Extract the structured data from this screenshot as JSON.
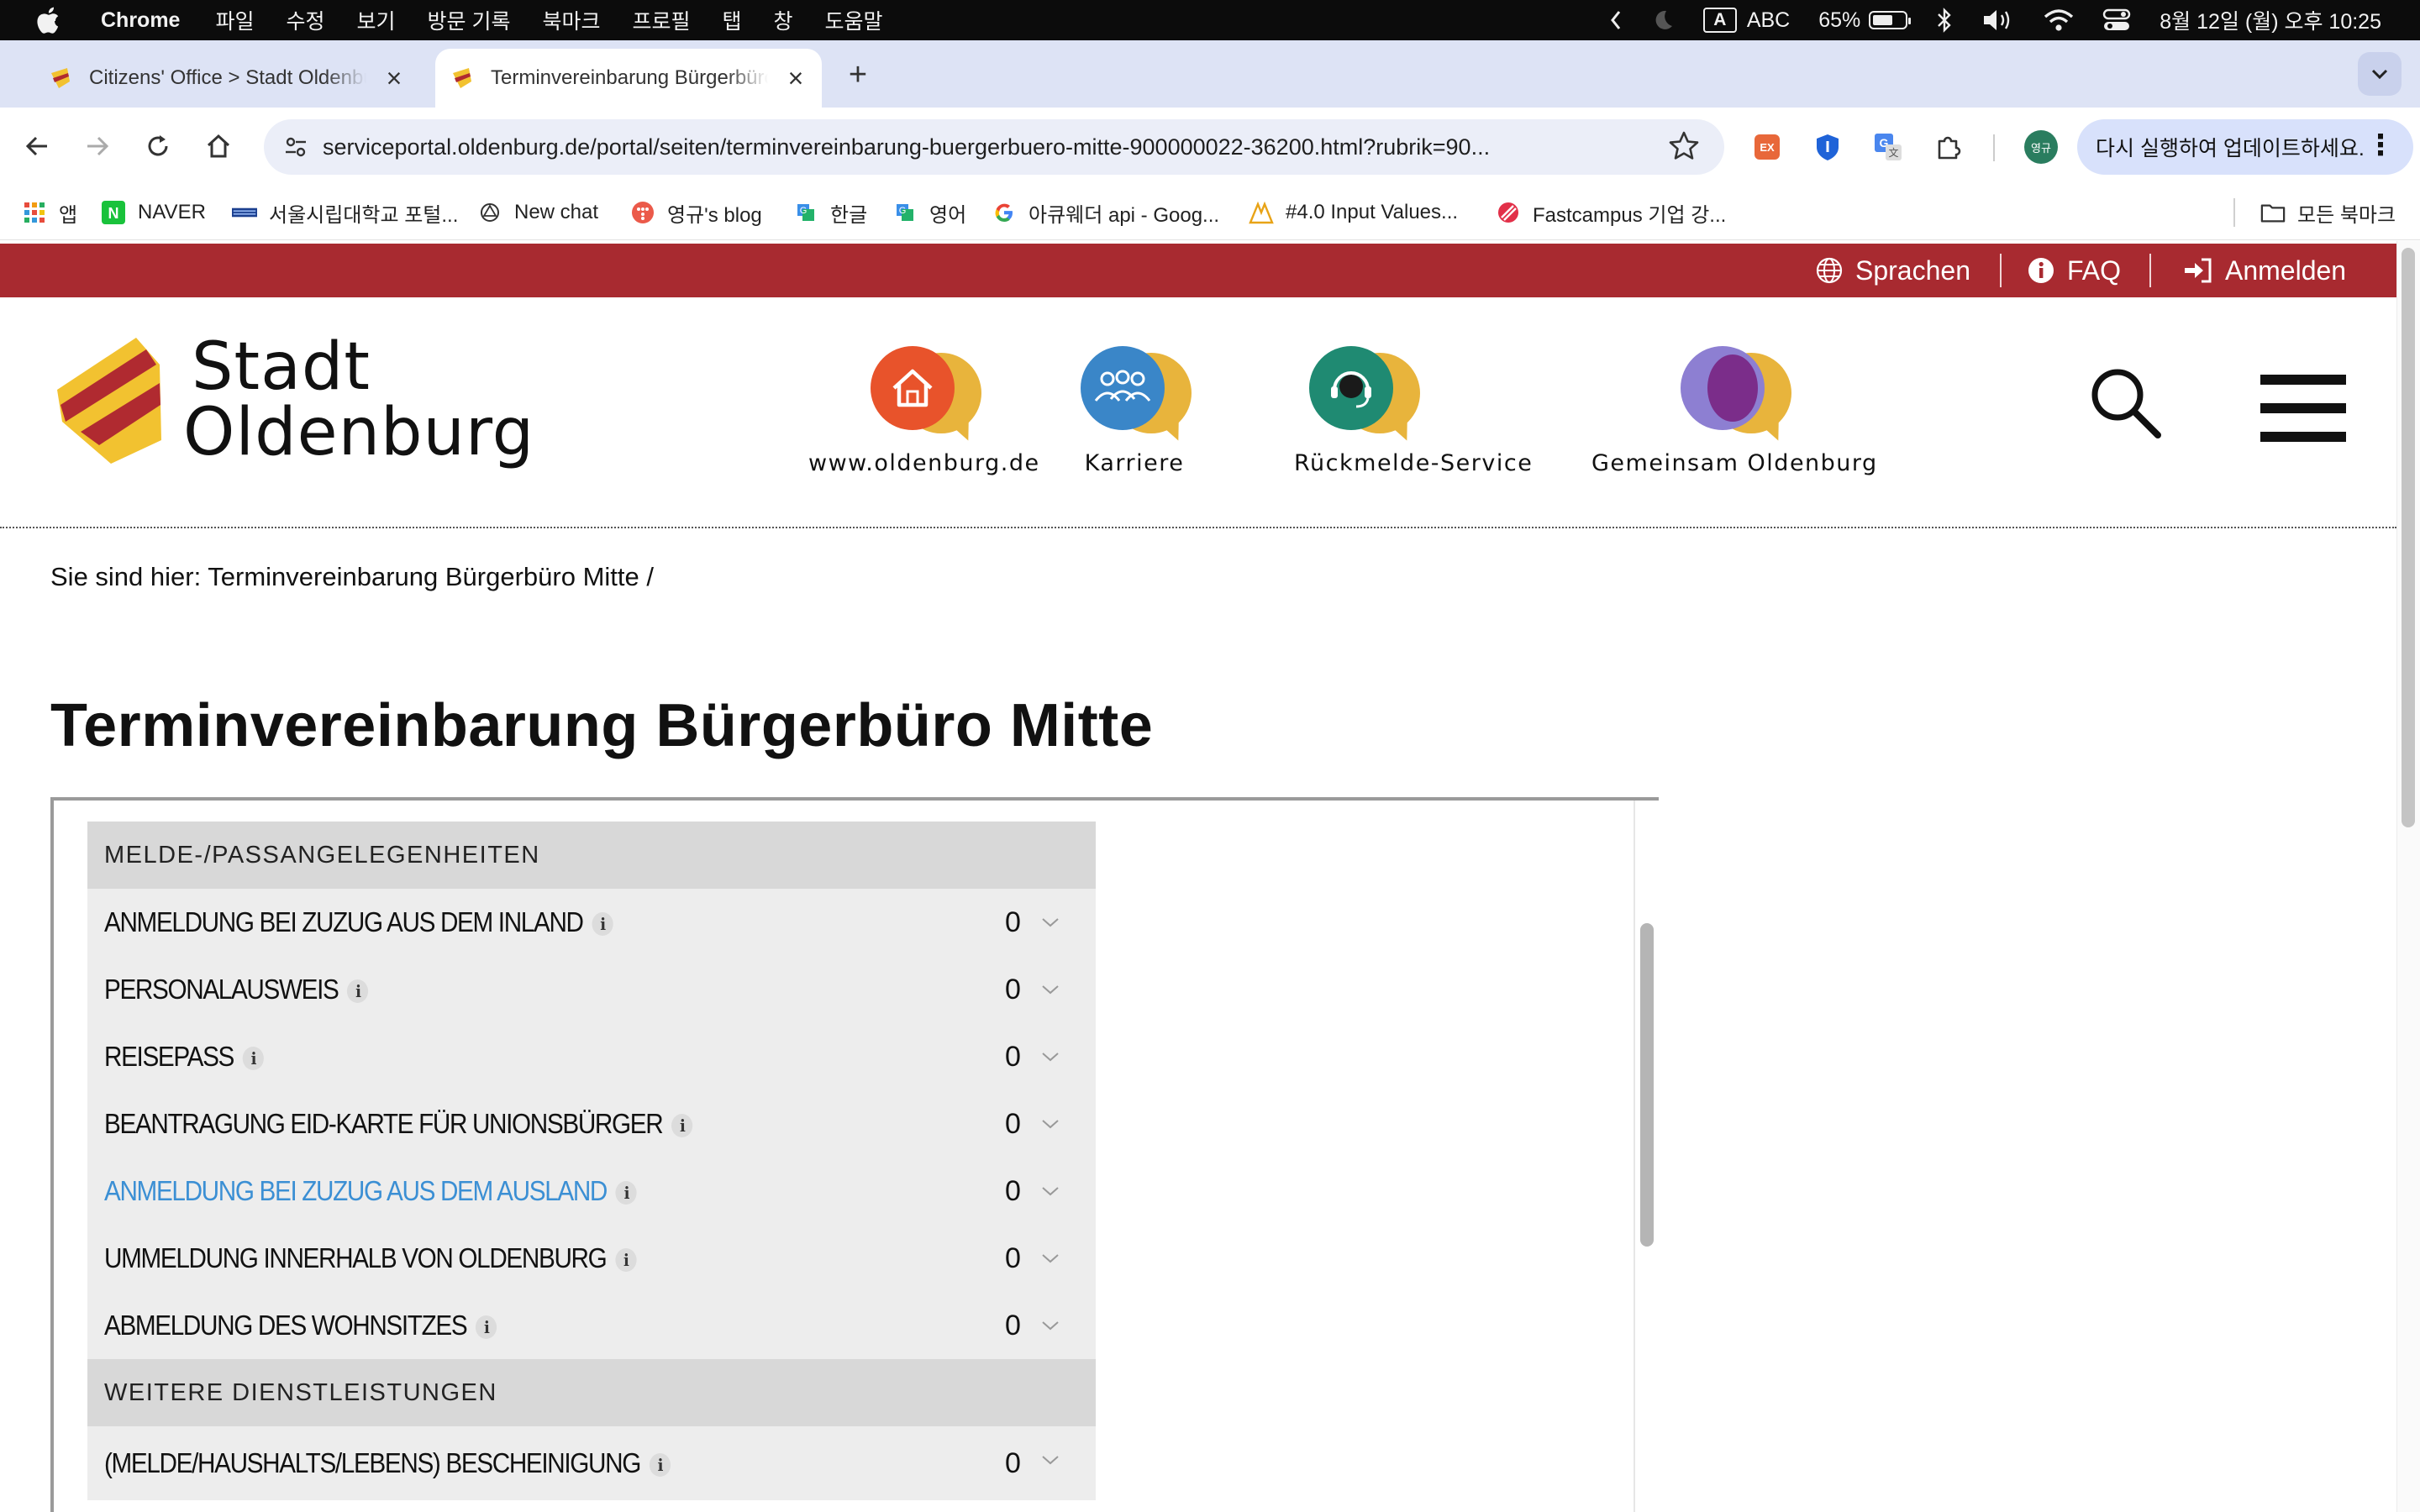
{
  "menubar": {
    "app": "Chrome",
    "items": [
      "파일",
      "수정",
      "보기",
      "방문 기록",
      "북마크",
      "프로필",
      "탭",
      "창",
      "도움말"
    ],
    "tray": {
      "input_method": "A",
      "input_label": "ABC",
      "battery": "65%",
      "battery_level": 0.65,
      "clock": "8월 12일 (월) 오후 10:25"
    }
  },
  "tabs": [
    {
      "title": "Citizens' Office > Stadt Oldenburg",
      "active": false
    },
    {
      "title": "Terminvereinbarung Bürgerbüro Mitte",
      "active": true
    }
  ],
  "toolbar": {
    "url": "serviceportal.oldenburg.de/portal/seiten/terminvereinbarung-buergerbuero-mitte-900000022-36200.html?rubrik=90...",
    "profile_label": "영규",
    "update_label": "다시 실행하여 업데이트하세요."
  },
  "bookmarks": [
    {
      "label": "앱",
      "icon": "apps-grid-icon"
    },
    {
      "label": "NAVER",
      "icon": "naver-icon"
    },
    {
      "label": "서울시립대학교 포털...",
      "icon": "uos-icon"
    },
    {
      "label": "New chat",
      "icon": "chatgpt-icon"
    },
    {
      "label": "영규's blog",
      "icon": "tistory-icon"
    },
    {
      "label": "한글",
      "icon": "translate-icon"
    },
    {
      "label": "영어",
      "icon": "translate-icon"
    },
    {
      "label": "아큐웨더 api - Goog...",
      "icon": "google-icon"
    },
    {
      "label": "#4.0 Input Values...",
      "icon": "nomad-icon"
    },
    {
      "label": "Fastcampus 기업 강...",
      "icon": "fastcampus-icon"
    }
  ],
  "bookmarks_all": "모든 북마크",
  "site": {
    "topbar": {
      "languages": "Sprachen",
      "faq": "FAQ",
      "login": "Anmelden"
    },
    "logo_line1": "Stadt",
    "logo_line2": "Oldenburg",
    "services": [
      {
        "label": "www.oldenburg.de",
        "icon": "home-icon",
        "color": "#e8532b"
      },
      {
        "label": "Karriere",
        "icon": "people-icon",
        "color": "#3a86c8"
      },
      {
        "label": "Rückmelde-Service",
        "icon": "headset-icon",
        "color": "#1f8a72"
      },
      {
        "label": "Gemeinsam Oldenburg",
        "icon": "speech-icon",
        "color": "#7b2d8a"
      }
    ],
    "breadcrumb_prefix": "Sie sind hier:",
    "breadcrumb_path": "Terminvereinbarung Bürgerbüro Mitte /",
    "title": "Terminvereinbarung Bürgerbüro Mitte",
    "categories": [
      {
        "name": "Melde-/Passangelegenheiten",
        "items": [
          {
            "name": "ANMELDUNG BEI ZUZUG AUS DEM INLAND",
            "count": "0"
          },
          {
            "name": "PERSONALAUSWEIS",
            "count": "0"
          },
          {
            "name": "REISEPASS",
            "count": "0"
          },
          {
            "name": "BEANTRAGUNG EID-KARTE FÜR UNIONSBÜRGER",
            "count": "0"
          },
          {
            "name": "ANMELDUNG BEI ZUZUG AUS DEM AUSLAND",
            "count": "0",
            "active": true
          },
          {
            "name": "UMMELDUNG INNERHALB VON OLDENBURG",
            "count": "0"
          },
          {
            "name": "ABMELDUNG DES WOHNSITZES",
            "count": "0"
          }
        ]
      },
      {
        "name": "Weitere Dienstleistungen",
        "items": [
          {
            "name": "(MELDE/HAUSHALTS/LEBENS) BESCHEINIGUNG",
            "count": "0"
          }
        ]
      }
    ],
    "info_glyph": "i"
  },
  "colors": {
    "brand_red": "#a82a30",
    "link_blue": "#3b8fd4",
    "logo_yellow": "#f2c230"
  }
}
